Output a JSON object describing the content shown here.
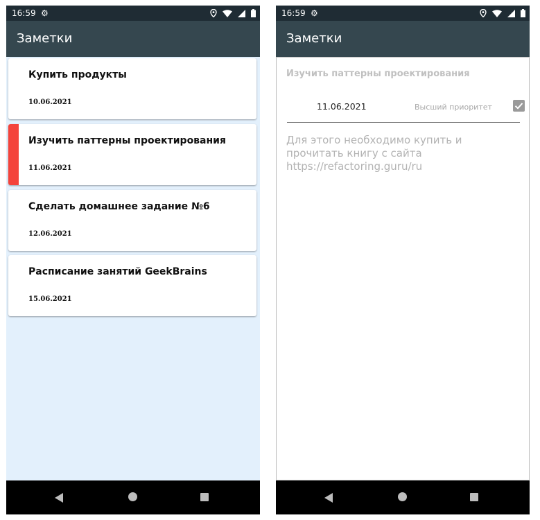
{
  "status_bar": {
    "time": "16:59"
  },
  "app_bar": {
    "title": "Заметки"
  },
  "notes": [
    {
      "title": "Купить продукты",
      "date": "10.06.2021",
      "high_priority": false
    },
    {
      "title": "Изучить паттерны проектирования",
      "date": "11.06.2021",
      "high_priority": true
    },
    {
      "title": "Сделать домашнее задание №6",
      "date": "12.06.2021",
      "high_priority": false
    },
    {
      "title": "Расписание занятий GeekBrains",
      "date": "15.06.2021",
      "high_priority": false
    }
  ],
  "detail": {
    "title": "Изучить паттерны проектирования",
    "date": "11.06.2021",
    "priority_label": "Высший приоритет",
    "priority_checked": true,
    "body_line1": "Для этого необходимо купить и",
    "body_line2": "прочитать книгу с сайта",
    "body_line3": "https://refactoring.guru/ru"
  },
  "icons": {
    "settings": "gear-icon",
    "location": "location-icon",
    "wifi": "wifi-icon",
    "signal": "signal-icon",
    "battery": "battery-icon",
    "back": "back-icon",
    "home": "home-icon",
    "recents": "recents-icon",
    "checkbox": "check-icon"
  },
  "colors": {
    "status_bar": "#1f2c34",
    "app_bar": "#35474f",
    "list_background": "#e3f0fc",
    "priority_marker": "#f4433b"
  }
}
